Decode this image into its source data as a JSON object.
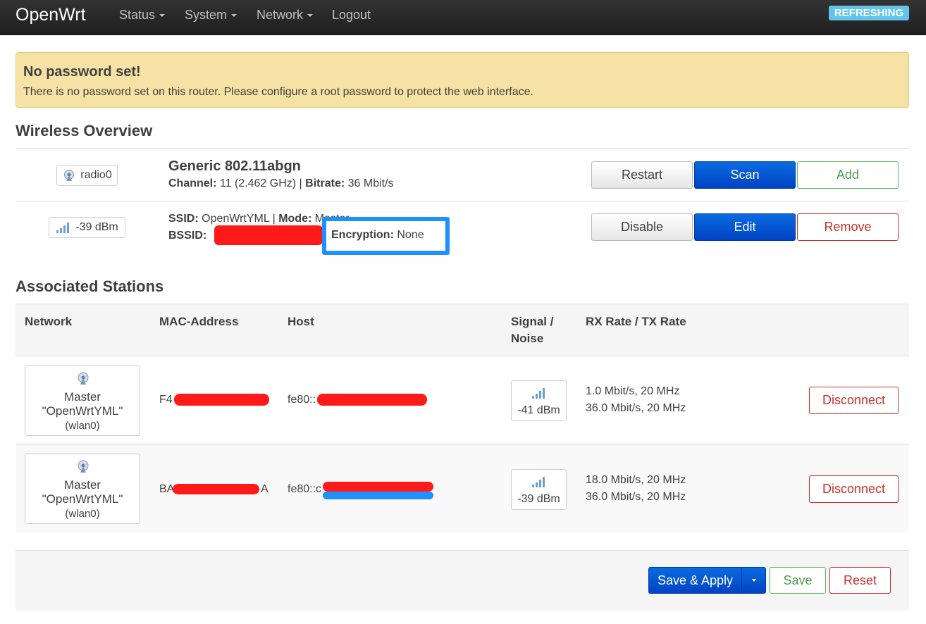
{
  "navbar": {
    "brand": "OpenWrt",
    "menus": [
      "Status",
      "System",
      "Network"
    ],
    "logout": "Logout",
    "badge": "REFRESHING"
  },
  "alert": {
    "title": "No password set!",
    "text": "There is no password set on this router. Please configure a root password to protect the web interface."
  },
  "wireless": {
    "heading": "Wireless Overview",
    "radio": {
      "label": "radio0",
      "name": "Generic 802.11abgn",
      "channel_label": "Channel:",
      "channel_value": "11 (2.462 GHz)",
      "bitrate_label": "Bitrate:",
      "bitrate_value": "36 Mbit/s",
      "buttons": [
        "Restart",
        "Scan",
        "Add"
      ]
    },
    "network": {
      "signal": "-39 dBm",
      "ssid_label": "SSID:",
      "ssid_value": "OpenWrtYML",
      "mode_label": "Mode:",
      "mode_value": "Master",
      "bssid_label": "BSSID:",
      "encryption_label": "Encryption:",
      "encryption_value": "None",
      "buttons": [
        "Disable",
        "Edit",
        "Remove"
      ]
    }
  },
  "stations": {
    "heading": "Associated Stations",
    "columns": [
      "Network",
      "MAC-Address",
      "Host",
      "Signal /",
      "Noise",
      "RX Rate / TX Rate"
    ],
    "rows": [
      {
        "mode": "Master",
        "ssid": "\"OpenWrtYML\"",
        "iface": "(wlan0)",
        "mac_prefix": "F4",
        "mac_suffix": "",
        "host_prefix": "fe80::",
        "signal": "-41 dBm",
        "rx": "1.0 Mbit/s, 20 MHz",
        "tx": "36.0 Mbit/s, 20 MHz",
        "action": "Disconnect"
      },
      {
        "mode": "Master",
        "ssid": "\"OpenWrtYML\"",
        "iface": "(wlan0)",
        "mac_prefix": "BA",
        "mac_suffix": "A",
        "host_prefix": "fe80::c",
        "signal": "-39 dBm",
        "rx": "18.0 Mbit/s, 20 MHz",
        "tx": "36.0 Mbit/s, 20 MHz",
        "action": "Disconnect"
      }
    ]
  },
  "footer": {
    "save_apply": "Save & Apply",
    "save": "Save",
    "reset": "Reset"
  },
  "colors": {
    "primary": "#0050d0",
    "success": "#5cb85c",
    "danger": "#c9302c",
    "alert_bg": "#f6e2a4",
    "badge": "#62c4ea",
    "redaction": "#ff1a1a",
    "highlight": "#1e90ff"
  }
}
